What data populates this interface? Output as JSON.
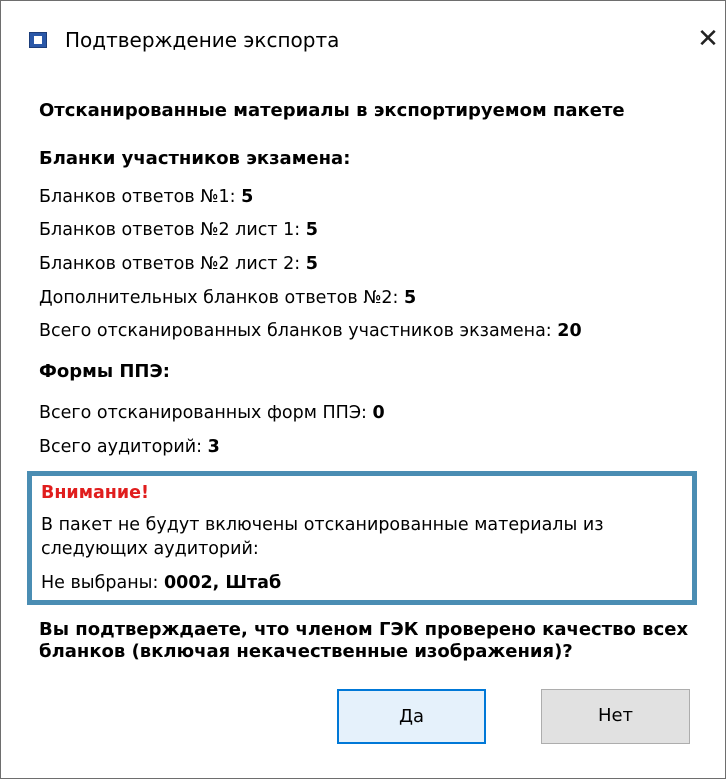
{
  "window": {
    "title": "Подтверждение экспорта",
    "icon": "app-window-icon",
    "close_label": "✕"
  },
  "content": {
    "main_heading": "Отсканированные материалы в экспортируемом пакете",
    "participants_heading": "Бланки участников экзамена:",
    "stats": [
      {
        "label": "Бланков ответов №1: ",
        "value": "5"
      },
      {
        "label": "Бланков ответов №2 лист 1: ",
        "value": "5"
      },
      {
        "label": "Бланков ответов №2 лист 2: ",
        "value": "5"
      },
      {
        "label": "Дополнительных бланков ответов №2: ",
        "value": "5"
      },
      {
        "label": "Всего отсканированных бланков участников экзамена: ",
        "value": "20"
      }
    ],
    "ppe_heading": "Формы ППЭ:",
    "ppe_stats": [
      {
        "label": "Всего отсканированных форм ППЭ: ",
        "value": "0"
      },
      {
        "label": "Всего аудиторий: ",
        "value": "3"
      }
    ]
  },
  "warning": {
    "title": "Внимание!",
    "text": "В пакет не будут включены отсканированные материалы из следующих аудиторий:",
    "not_selected_label": "Не выбраны: ",
    "not_selected_value": "0002, Штаб",
    "border_color": "#4a8db3",
    "title_color": "#e01d1d"
  },
  "question": "Вы подтверждаете, что членом ГЭК проверено качество всех бланков (включая некачественные изображения)?",
  "buttons": {
    "yes": "Да",
    "no": "Нет"
  }
}
